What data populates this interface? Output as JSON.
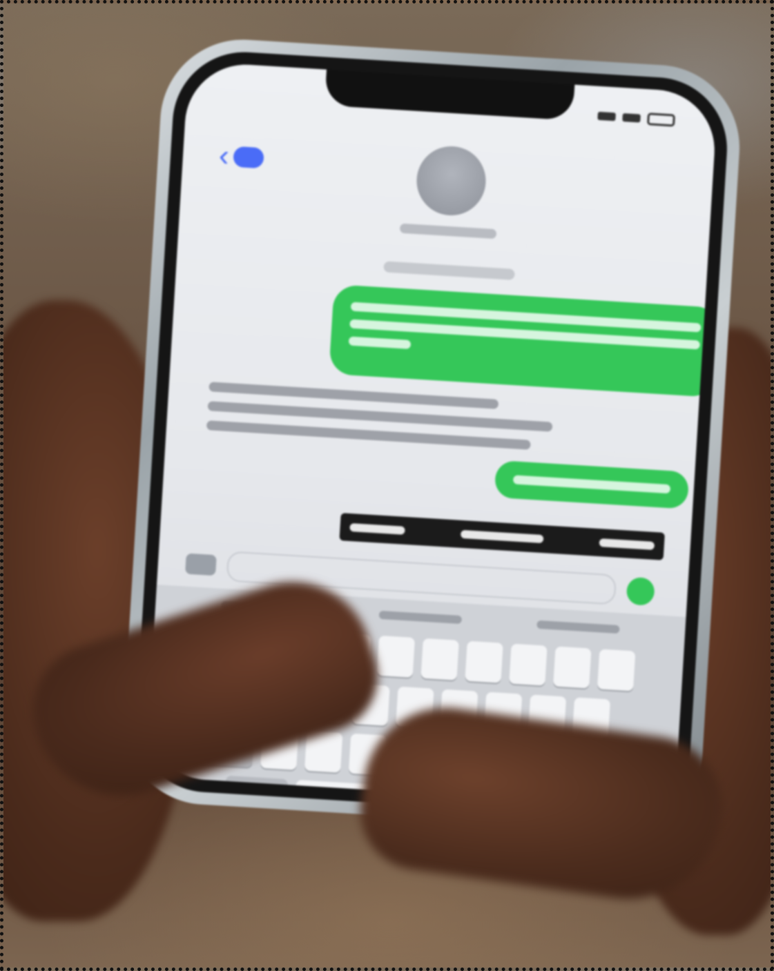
{
  "palette": {
    "message_out_green": "#35c759",
    "ios_blue": "#4a6cf7",
    "keyboard_gray": "#cfd2d7"
  },
  "icons": {
    "back": "chevron-left-icon",
    "avatar": "contact-avatar-icon",
    "apps": "apps-icon",
    "send": "send-icon"
  }
}
